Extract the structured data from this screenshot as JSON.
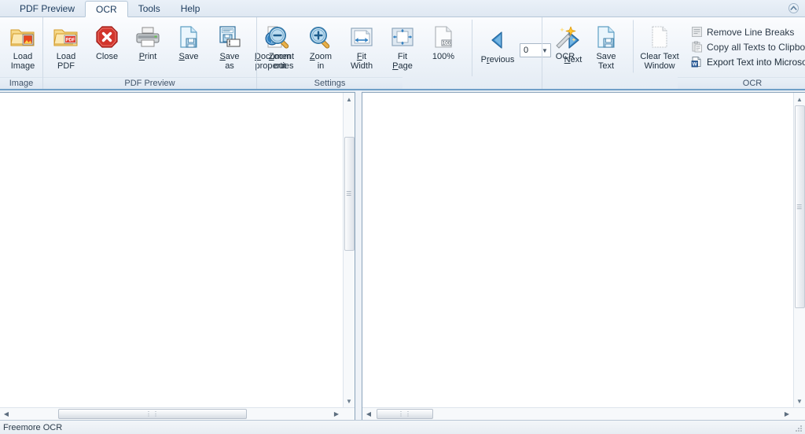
{
  "window": {
    "title_bar_minimize_icon": "chevron-up-icon",
    "status_text": "Freemore OCR"
  },
  "tabs": [
    {
      "label": "PDF Preview",
      "active": false
    },
    {
      "label": "OCR",
      "active": true
    },
    {
      "label": "Tools",
      "active": false
    },
    {
      "label": "Help",
      "active": false
    }
  ],
  "ribbon": {
    "groups": [
      {
        "name": "image",
        "label": "Image",
        "buttons": [
          {
            "id": "load-image",
            "line1": "Load",
            "line2": "Image",
            "icon": "folder-image-icon"
          }
        ]
      },
      {
        "name": "pdf-preview",
        "label": "PDF Preview",
        "buttons": [
          {
            "id": "load-pdf",
            "line1": "Load",
            "line2": "PDF",
            "icon": "folder-pdf-icon"
          },
          {
            "id": "close",
            "line1": "Close",
            "line2": "",
            "icon": "close-octagon-icon"
          },
          {
            "id": "print",
            "line1": "Print",
            "line2": "",
            "icon": "printer-icon"
          },
          {
            "id": "save",
            "line1": "Save",
            "line2": "",
            "icon": "save-document-icon"
          },
          {
            "id": "save-as",
            "line1": "Save",
            "line2": "as",
            "icon": "save-as-icon"
          },
          {
            "id": "document-properties",
            "line1": "Document",
            "line2": "properties",
            "icon": "document-info-icon"
          }
        ]
      },
      {
        "name": "settings",
        "label": "Settings",
        "buttons": [
          {
            "id": "zoom-out",
            "line1": "Zoom",
            "line2": "out",
            "icon": "magnifier-minus-icon"
          },
          {
            "id": "zoom-in",
            "line1": "Zoom",
            "line2": "in",
            "icon": "magnifier-plus-icon"
          },
          {
            "id": "fit-width",
            "line1": "Fit",
            "line2": "Width",
            "icon": "fit-width-icon"
          },
          {
            "id": "fit-page",
            "line1": "Fit",
            "line2": "Page",
            "icon": "fit-page-icon"
          },
          {
            "id": "zoom-100",
            "line1": "100%",
            "line2": "",
            "icon": "page-100-icon"
          }
        ],
        "nav": {
          "previous_label": "Previous",
          "previous_icon": "triangle-left-icon",
          "next_label": "Next",
          "next_icon": "triangle-right-icon",
          "page_value": "0",
          "page_dropdown_icon": "chevron-down-icon"
        }
      },
      {
        "name": "ocr",
        "label": "OCR",
        "buttons": [
          {
            "id": "ocr",
            "line1": "OCR",
            "line2": "",
            "icon": "magic-wand-icon"
          },
          {
            "id": "save-text",
            "line1": "Save",
            "line2": "Text",
            "icon": "save-text-icon"
          },
          {
            "id": "clear-text-window",
            "line1": "Clear Text",
            "line2": "Window",
            "icon": "blank-page-icon"
          }
        ],
        "small_buttons": [
          {
            "id": "remove-line-breaks",
            "label": "Remove Line Breaks",
            "icon": "line-breaks-icon",
            "disabled": true
          },
          {
            "id": "copy-all-texts-to-clipboard",
            "label": "Copy all Texts to Clipboard",
            "icon": "clipboard-icon",
            "disabled": true
          },
          {
            "id": "export-text-into-microsoft-word",
            "label": "Export Text into Microsoft Word",
            "icon": "word-export-icon",
            "disabled": false
          }
        ]
      }
    ]
  },
  "panes": {
    "left": {
      "name": "pdf-preview-pane",
      "content": "",
      "vscroll": {
        "up_icon": "triangle-up-icon",
        "down_icon": "triangle-down-icon",
        "thumb_grip": "≡"
      },
      "hscroll": {
        "left_icon": "triangle-left-icon",
        "right_icon": "triangle-right-icon",
        "thumb_grip": "⦀"
      }
    },
    "right": {
      "name": "ocr-text-pane",
      "content": "",
      "vscroll": {
        "up_icon": "triangle-up-icon",
        "down_icon": "triangle-down-icon",
        "thumb_grip": "≡"
      },
      "hscroll": {
        "left_icon": "triangle-left-icon",
        "right_icon": "triangle-right-icon",
        "thumb_grip": "⦀"
      }
    }
  },
  "colors": {
    "ribbon_accent": "#6f9fc8",
    "folder": "#f2c14b",
    "close_red": "#cc2127",
    "nav_blue": "#2e7ec4",
    "doc_blue": "#9cc8e4"
  }
}
